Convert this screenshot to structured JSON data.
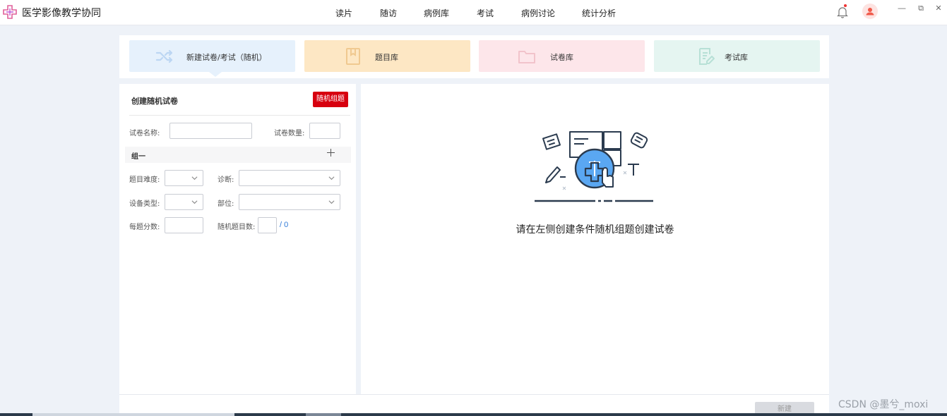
{
  "app": {
    "title": "医学影像教学协同"
  },
  "nav": {
    "items": [
      "读片",
      "随访",
      "病例库",
      "考试",
      "病例讨论",
      "统计分析"
    ]
  },
  "window": {
    "minimize": "—",
    "restore": "⧉",
    "close": "✕"
  },
  "cards": [
    {
      "label": "新建试卷/考试（随机）",
      "icon": "shuffle-icon",
      "bg": "#e6f1fc",
      "color": "#bcd6f3"
    },
    {
      "label": "题目库",
      "icon": "bookmark-icon",
      "bg": "#fde7c4",
      "color": "#f0c990"
    },
    {
      "label": "试卷库",
      "icon": "folder-icon",
      "bg": "#fde6ea",
      "color": "#f2c3cb"
    },
    {
      "label": "考试库",
      "icon": "edit-document-icon",
      "bg": "#e5f5f1",
      "color": "#b7e0d6"
    }
  ],
  "form": {
    "title": "创建随机试卷",
    "random_button": "随机组题",
    "paper_name_label": "试卷名称:",
    "paper_count_label": "试卷数量:",
    "group_label": "组一",
    "difficulty_label": "题目难度:",
    "diagnosis_label": "诊断:",
    "device_type_label": "设备类型:",
    "body_part_label": "部位:",
    "score_label": "每题分数:",
    "random_count_label": "随机题目数:",
    "random_count_total": "/ 0"
  },
  "empty_state": {
    "message": "请在左侧创建条件随机组题创建试卷"
  },
  "footer": {
    "new_button": "新建"
  },
  "watermark": "CSDN @墨兮_moxi",
  "colors": {
    "accent_red": "#d7000f",
    "link_blue": "#2f7ad8",
    "illustration_blue": "#5aa7f2"
  }
}
